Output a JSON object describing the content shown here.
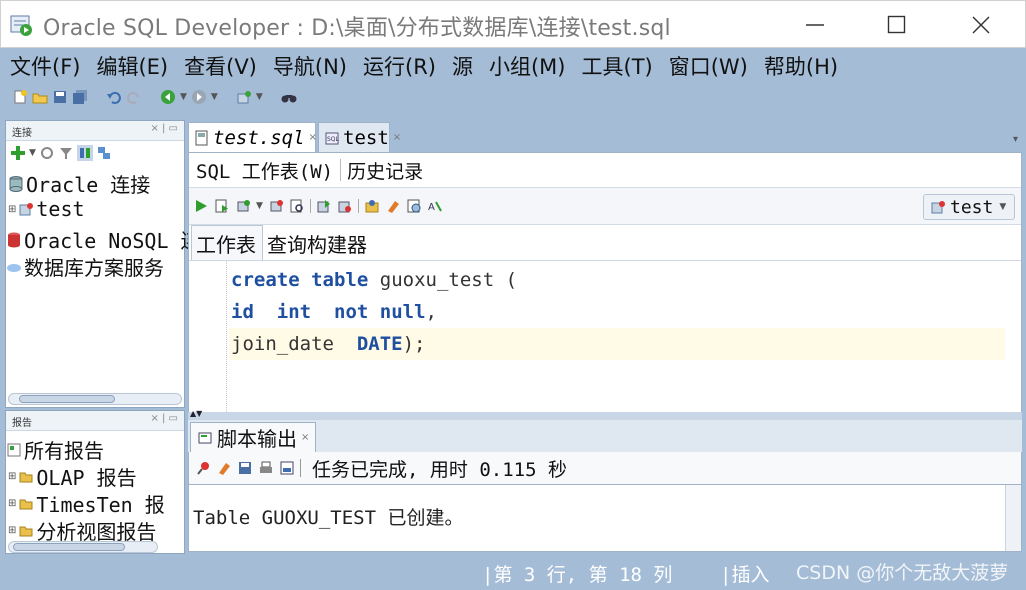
{
  "window": {
    "title": "Oracle SQL Developer : D:\\桌面\\分布式数据库\\连接\\test.sql"
  },
  "menu": [
    "文件(F)",
    "编辑(E)",
    "查看(V)",
    "导航(N)",
    "运行(R)",
    "源",
    "小组(M)",
    "工具(T)",
    "窗口(W)",
    "帮助(H)"
  ],
  "connections_pane": {
    "header": "连接",
    "items": [
      "Oracle 连接",
      "test",
      "Oracle NoSQL 连",
      "数据库方案服务"
    ]
  },
  "reports_pane": {
    "header": "报告",
    "items": [
      "所有报告",
      "OLAP 报告",
      "TimesTen 报",
      "分析视图报告"
    ]
  },
  "editor_tabs": [
    "test.sql",
    "test"
  ],
  "subtabs": [
    "SQL 工作表(W)",
    "历史记录"
  ],
  "connection_selector": "test",
  "worksheet_tabs": [
    "工作表",
    "查询构建器"
  ],
  "code": {
    "line1": {
      "kw1": "create",
      "kw2": "table",
      "name": "guoxu_test",
      "paren": "("
    },
    "line2": {
      "col": "id",
      "type": "int",
      "kw": "not null",
      "comma": ","
    },
    "line3": {
      "col": "join_date",
      "type": "DATE",
      "end": ");"
    }
  },
  "script_output": {
    "tab": "脚本输出",
    "status": "任务已完成, 用时 0.115 秒",
    "text": "Table GUOXU_TEST 已创建。"
  },
  "statusbar": {
    "position": "第 3 行, 第 18 列",
    "mode": "插入",
    "watermark": "CSDN @你个无敌大菠萝"
  },
  "colors": {
    "chrome": "#a4bcd6",
    "keyword": "#1e4fa0",
    "highlight_line": "#fffbe6"
  }
}
